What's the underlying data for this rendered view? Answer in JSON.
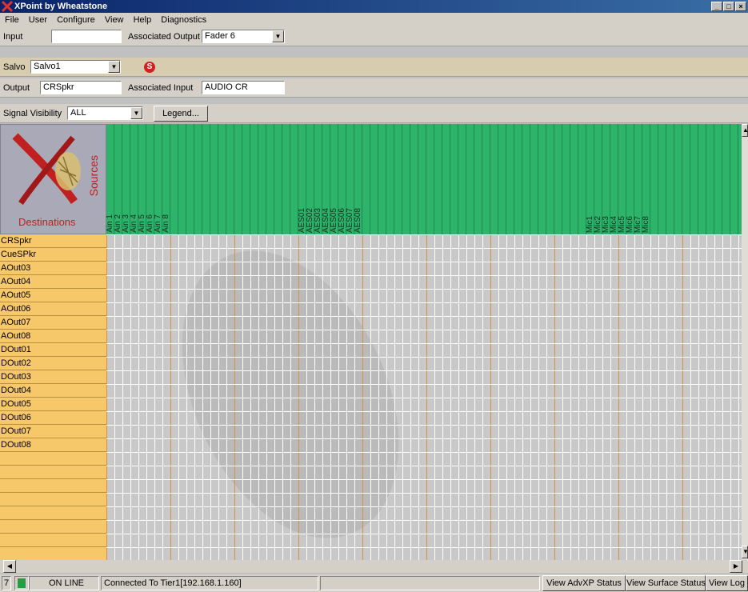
{
  "window": {
    "title": "XPoint by Wheatstone"
  },
  "menu": [
    "File",
    "User",
    "Configure",
    "View",
    "Help",
    "Diagnostics"
  ],
  "input_row": {
    "input_label": "Input",
    "input_value": "",
    "assoc_output_label": "Associated Output",
    "assoc_output_value": "Fader 6"
  },
  "salvo_row": {
    "salvo_label": "Salvo",
    "salvo_value": "Salvo1",
    "salvo_badge": "S"
  },
  "output_row": {
    "output_label": "Output",
    "output_value": "CRSpkr",
    "assoc_input_label": "Associated Input",
    "assoc_input_value": "AUDIO CR"
  },
  "visibility_row": {
    "label": "Signal Visibility",
    "value": "ALL",
    "legend_button": "Legend..."
  },
  "grid": {
    "sources_label": "Sources",
    "destinations_label": "Destinations",
    "source_columns": [
      "Ain 1",
      "Ain 2",
      "Ain 3",
      "Ain 4",
      "Ain 5",
      "Ain 6",
      "Ain 7",
      "Ain 8",
      "",
      "",
      "",
      "",
      "",
      "",
      "",
      "",
      "",
      "",
      "",
      "",
      "",
      "",
      "",
      "",
      "AES01",
      "AES02",
      "AES03",
      "AES04",
      "AES05",
      "AES06",
      "AES07",
      "AES08",
      "",
      "",
      "",
      "",
      "",
      "",
      "",
      "",
      "",
      "",
      "",
      "",
      "",
      "",
      "",
      "",
      "",
      "",
      "",
      "",
      "",
      "",
      "",
      "",
      "",
      "",
      "",
      "",
      "Mic1",
      "Mic2",
      "Mic3",
      "Mic4",
      "Mic5",
      "Mic6",
      "Mic7",
      "Mic8"
    ],
    "destinations": [
      "CRSpkr",
      "CueSPkr",
      "AOut03",
      "AOut04",
      "AOut05",
      "AOut06",
      "AOut07",
      "AOut08",
      "DOut01",
      "DOut02",
      "DOut03",
      "DOut04",
      "DOut05",
      "DOut06",
      "DOut07",
      "DOut08"
    ],
    "total_source_cols": 79,
    "total_dest_rows": 24,
    "colors": {
      "source_header": "#2db36a",
      "dest_col": "#f7c86a",
      "matrix": "#c8c8c8",
      "grid_line": "#ffffff",
      "accent_line": "#d09050"
    }
  },
  "status": {
    "channel_number": "7",
    "online_text": "ON LINE",
    "connection_text": "Connected To Tier1[192.168.1.160]",
    "btn_advxp": "View AdvXP Status",
    "btn_surface": "View Surface Status",
    "btn_log": "View Log"
  }
}
